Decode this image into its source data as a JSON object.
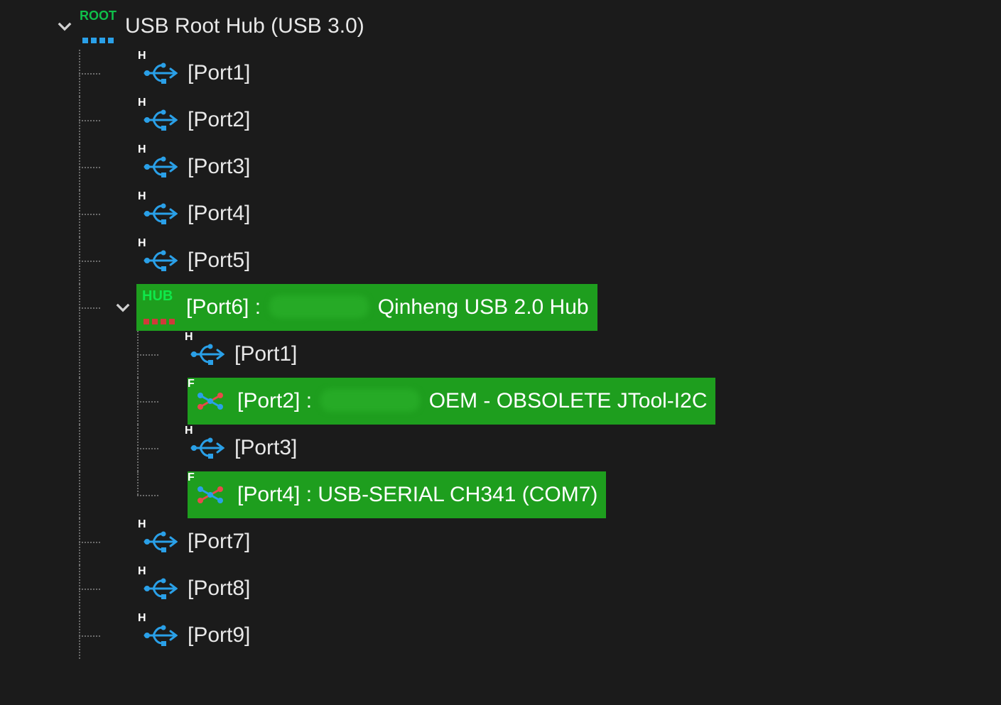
{
  "root": {
    "label": "USB Root Hub (USB 3.0)",
    "icon": "root",
    "expanded": true,
    "children": [
      {
        "label": "[Port1]",
        "icon": "usb",
        "badge": "H"
      },
      {
        "label": "[Port2]",
        "icon": "usb",
        "badge": "H"
      },
      {
        "label": "[Port3]",
        "icon": "usb",
        "badge": "H"
      },
      {
        "label": "[Port4]",
        "icon": "usb",
        "badge": "H"
      },
      {
        "label": "[Port5]",
        "icon": "usb",
        "badge": "H"
      },
      {
        "label_prefix": "[Port6] : ",
        "label_suffix": " Qinheng USB 2.0 Hub",
        "redacted": true,
        "icon": "hub",
        "highlight": true,
        "expanded": true,
        "children": [
          {
            "label": "[Port1]",
            "icon": "usb",
            "badge": "H"
          },
          {
            "label_prefix": "[Port2] : ",
            "label_suffix": " OEM - OBSOLETE JTool-I2C",
            "redacted": true,
            "icon": "device",
            "badge": "F",
            "highlight": true
          },
          {
            "label": "[Port3]",
            "icon": "usb",
            "badge": "H"
          },
          {
            "label": "[Port4] : USB-SERIAL CH341 (COM7)",
            "icon": "device",
            "badge": "F",
            "highlight": true
          }
        ]
      },
      {
        "label": "[Port7]",
        "icon": "usb",
        "badge": "H"
      },
      {
        "label": "[Port8]",
        "icon": "usb",
        "badge": "H"
      },
      {
        "label": "[Port9]",
        "icon": "usb",
        "badge": "H"
      }
    ]
  },
  "colors": {
    "bg": "#1b1b1b",
    "highlight": "#1e9e1e",
    "usb_icon": "#2aa0e8",
    "device_icon_blue": "#2aa0e8",
    "device_icon_red": "#e84a4a",
    "text": "#e8e8e8"
  }
}
